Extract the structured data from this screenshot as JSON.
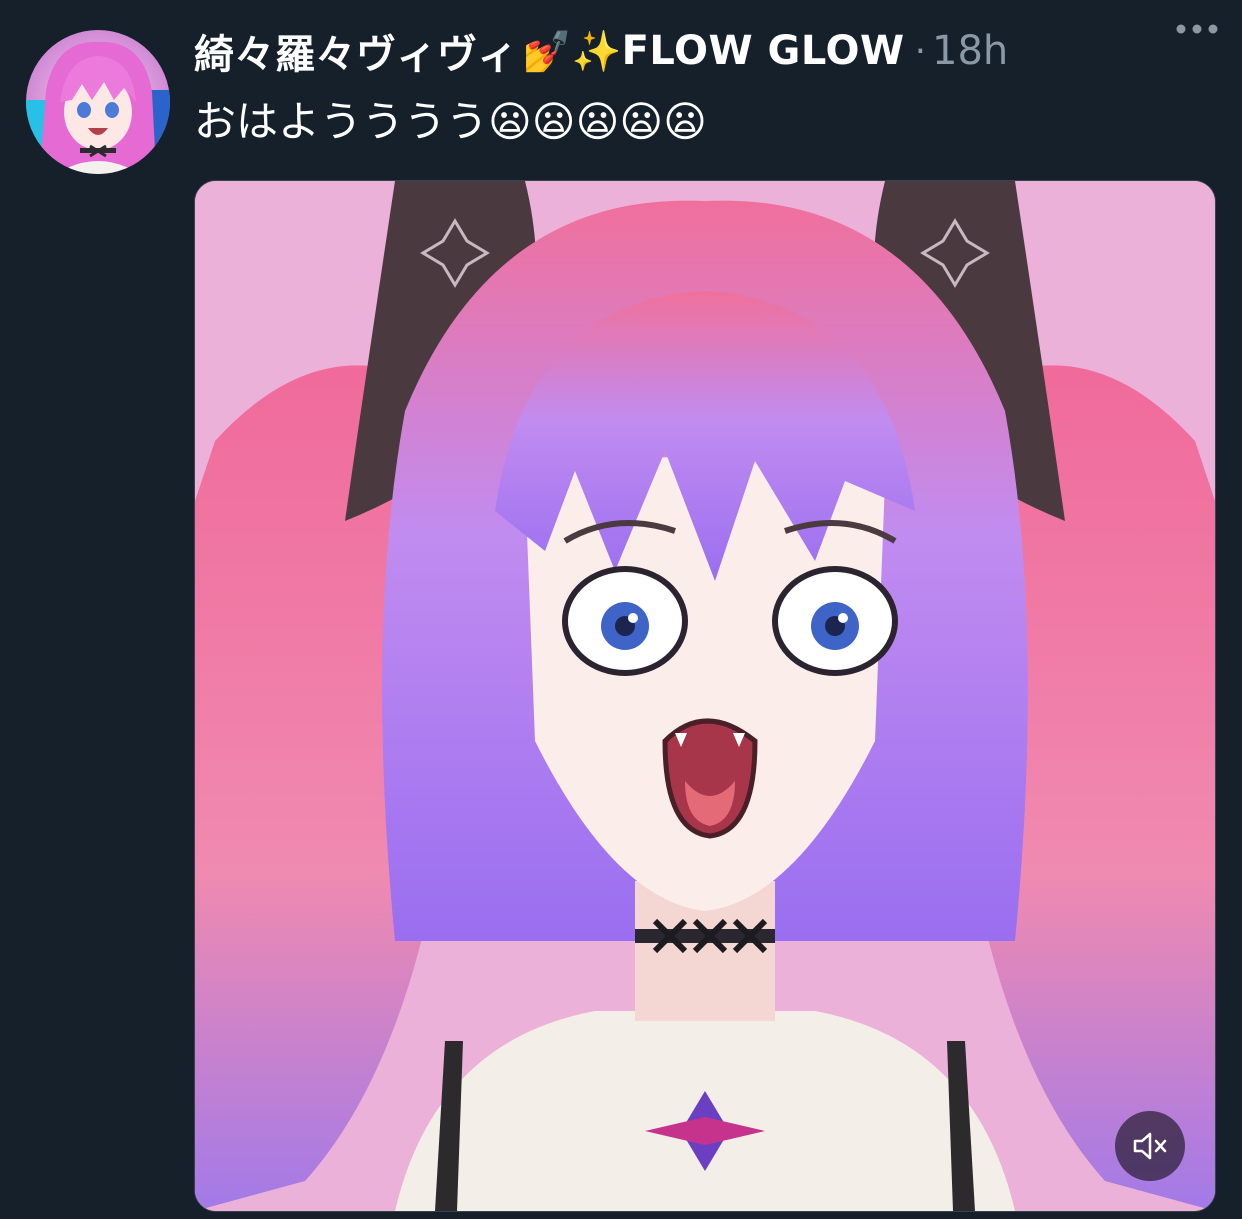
{
  "author": {
    "display_name": "綺々羅々ヴィヴィ",
    "name_emojis": "💅✨",
    "badge_text": "FLOW GLOW",
    "separator": "·",
    "timestamp": "18h",
    "avatar_icon": "avatar-anime-girl-icon"
  },
  "tweet": {
    "text": "おはようううう😦😦😦😦😦"
  },
  "media": {
    "type": "video",
    "description_icon": "anime-girl-video",
    "muted": true,
    "mute_icon": "speaker-muted-icon"
  },
  "colors": {
    "background": "#15202b",
    "text_primary": "#ffffff",
    "text_secondary": "#8b98a5",
    "media_background": "#ecb1d8"
  }
}
